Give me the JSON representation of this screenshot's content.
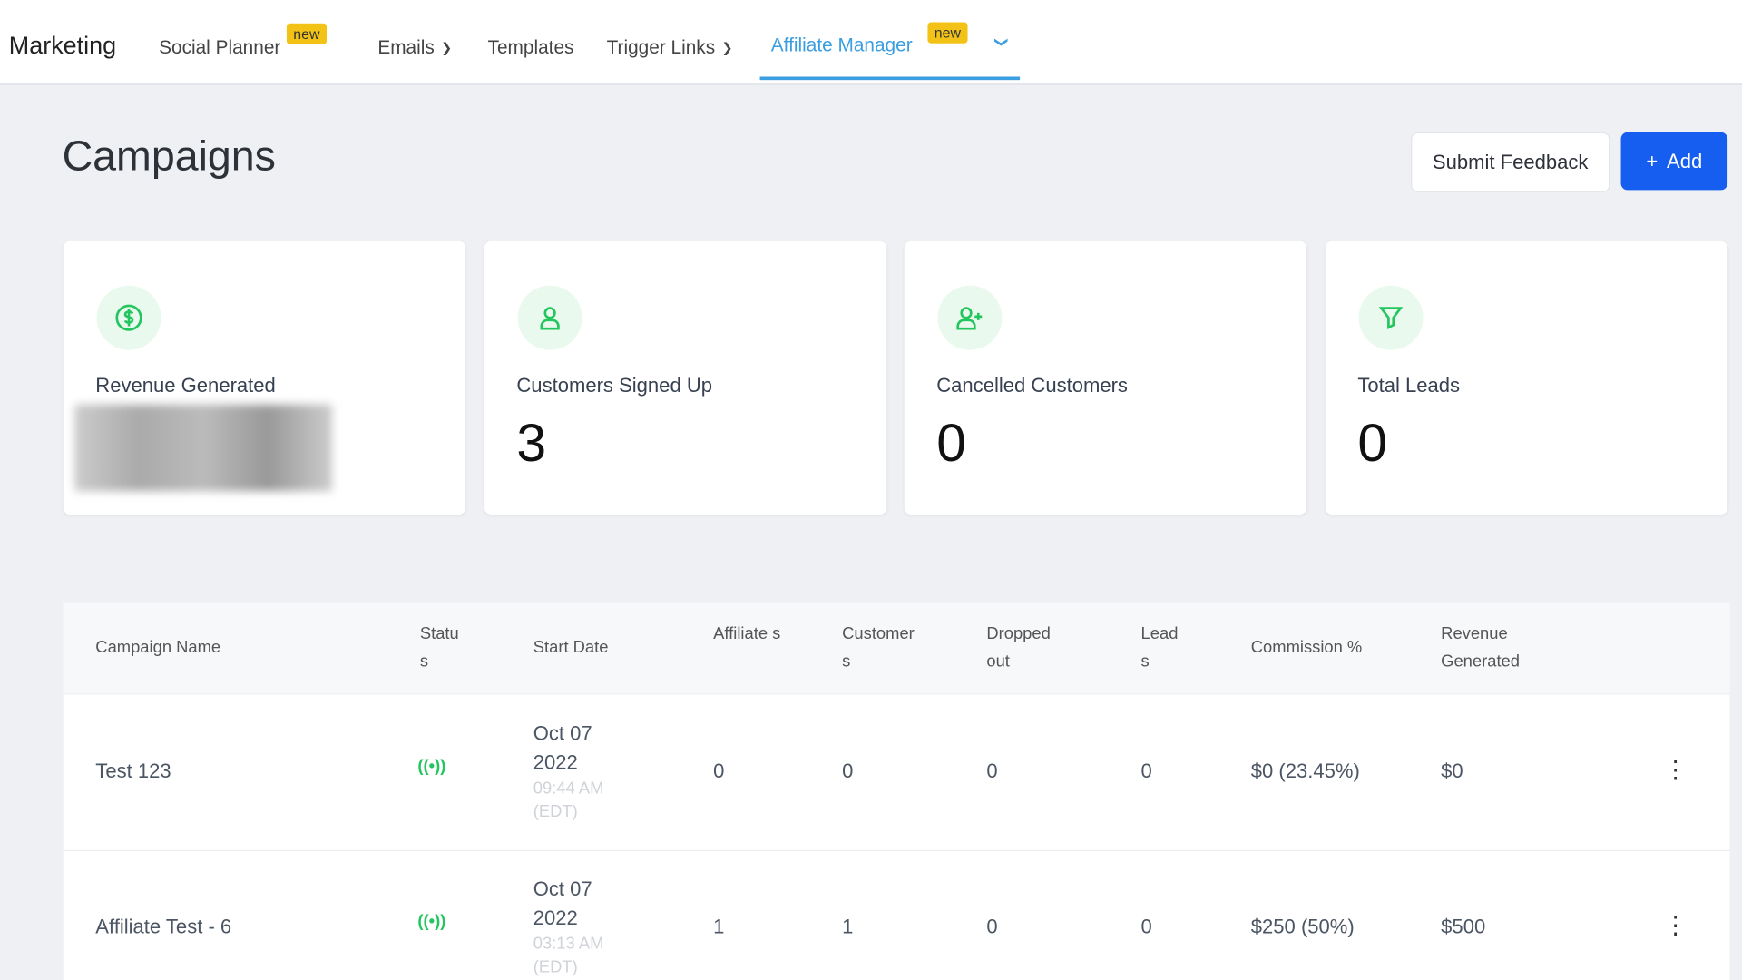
{
  "nav": {
    "brand": "Marketing",
    "items": [
      {
        "label": "Social Planner",
        "badge": "new"
      },
      {
        "label": "Emails"
      },
      {
        "label": "Templates"
      },
      {
        "label": "Trigger Links"
      },
      {
        "label": "Affiliate Manager",
        "badge": "new",
        "active": true
      }
    ]
  },
  "page": {
    "title": "Campaigns",
    "feedback": "Submit Feedback",
    "add": "Add"
  },
  "cards": [
    {
      "label": "Revenue Generated",
      "value": null,
      "icon": "dollar-icon"
    },
    {
      "label": "Customers Signed Up",
      "value": "3",
      "icon": "user-icon"
    },
    {
      "label": "Cancelled Customers",
      "value": "0",
      "icon": "user-plus-icon"
    },
    {
      "label": "Total Leads",
      "value": "0",
      "icon": "funnel-icon"
    }
  ],
  "table": {
    "headers": [
      "Campaign Name",
      "Statu s",
      "Start Date",
      "Affiliate s",
      "Customer s",
      "Dropped out",
      "Lead s",
      "Commission %",
      "Revenue Generated"
    ],
    "rows": [
      {
        "name": "Test 123",
        "date": "Oct 07",
        "year": "2022",
        "time": "09:44 AM",
        "tz": "(EDT)",
        "affiliates": "0",
        "customers": "0",
        "dropped": "0",
        "leads": "0",
        "commission": "$0 (23.45%)",
        "revenue": "$0"
      },
      {
        "name": "Affiliate Test - 6",
        "date": "Oct 07",
        "year": "2022",
        "time": "03:13 AM",
        "tz": "(EDT)",
        "affiliates": "1",
        "customers": "1",
        "dropped": "0",
        "leads": "0",
        "commission": "$250 (50%)",
        "revenue": "$500"
      }
    ]
  }
}
